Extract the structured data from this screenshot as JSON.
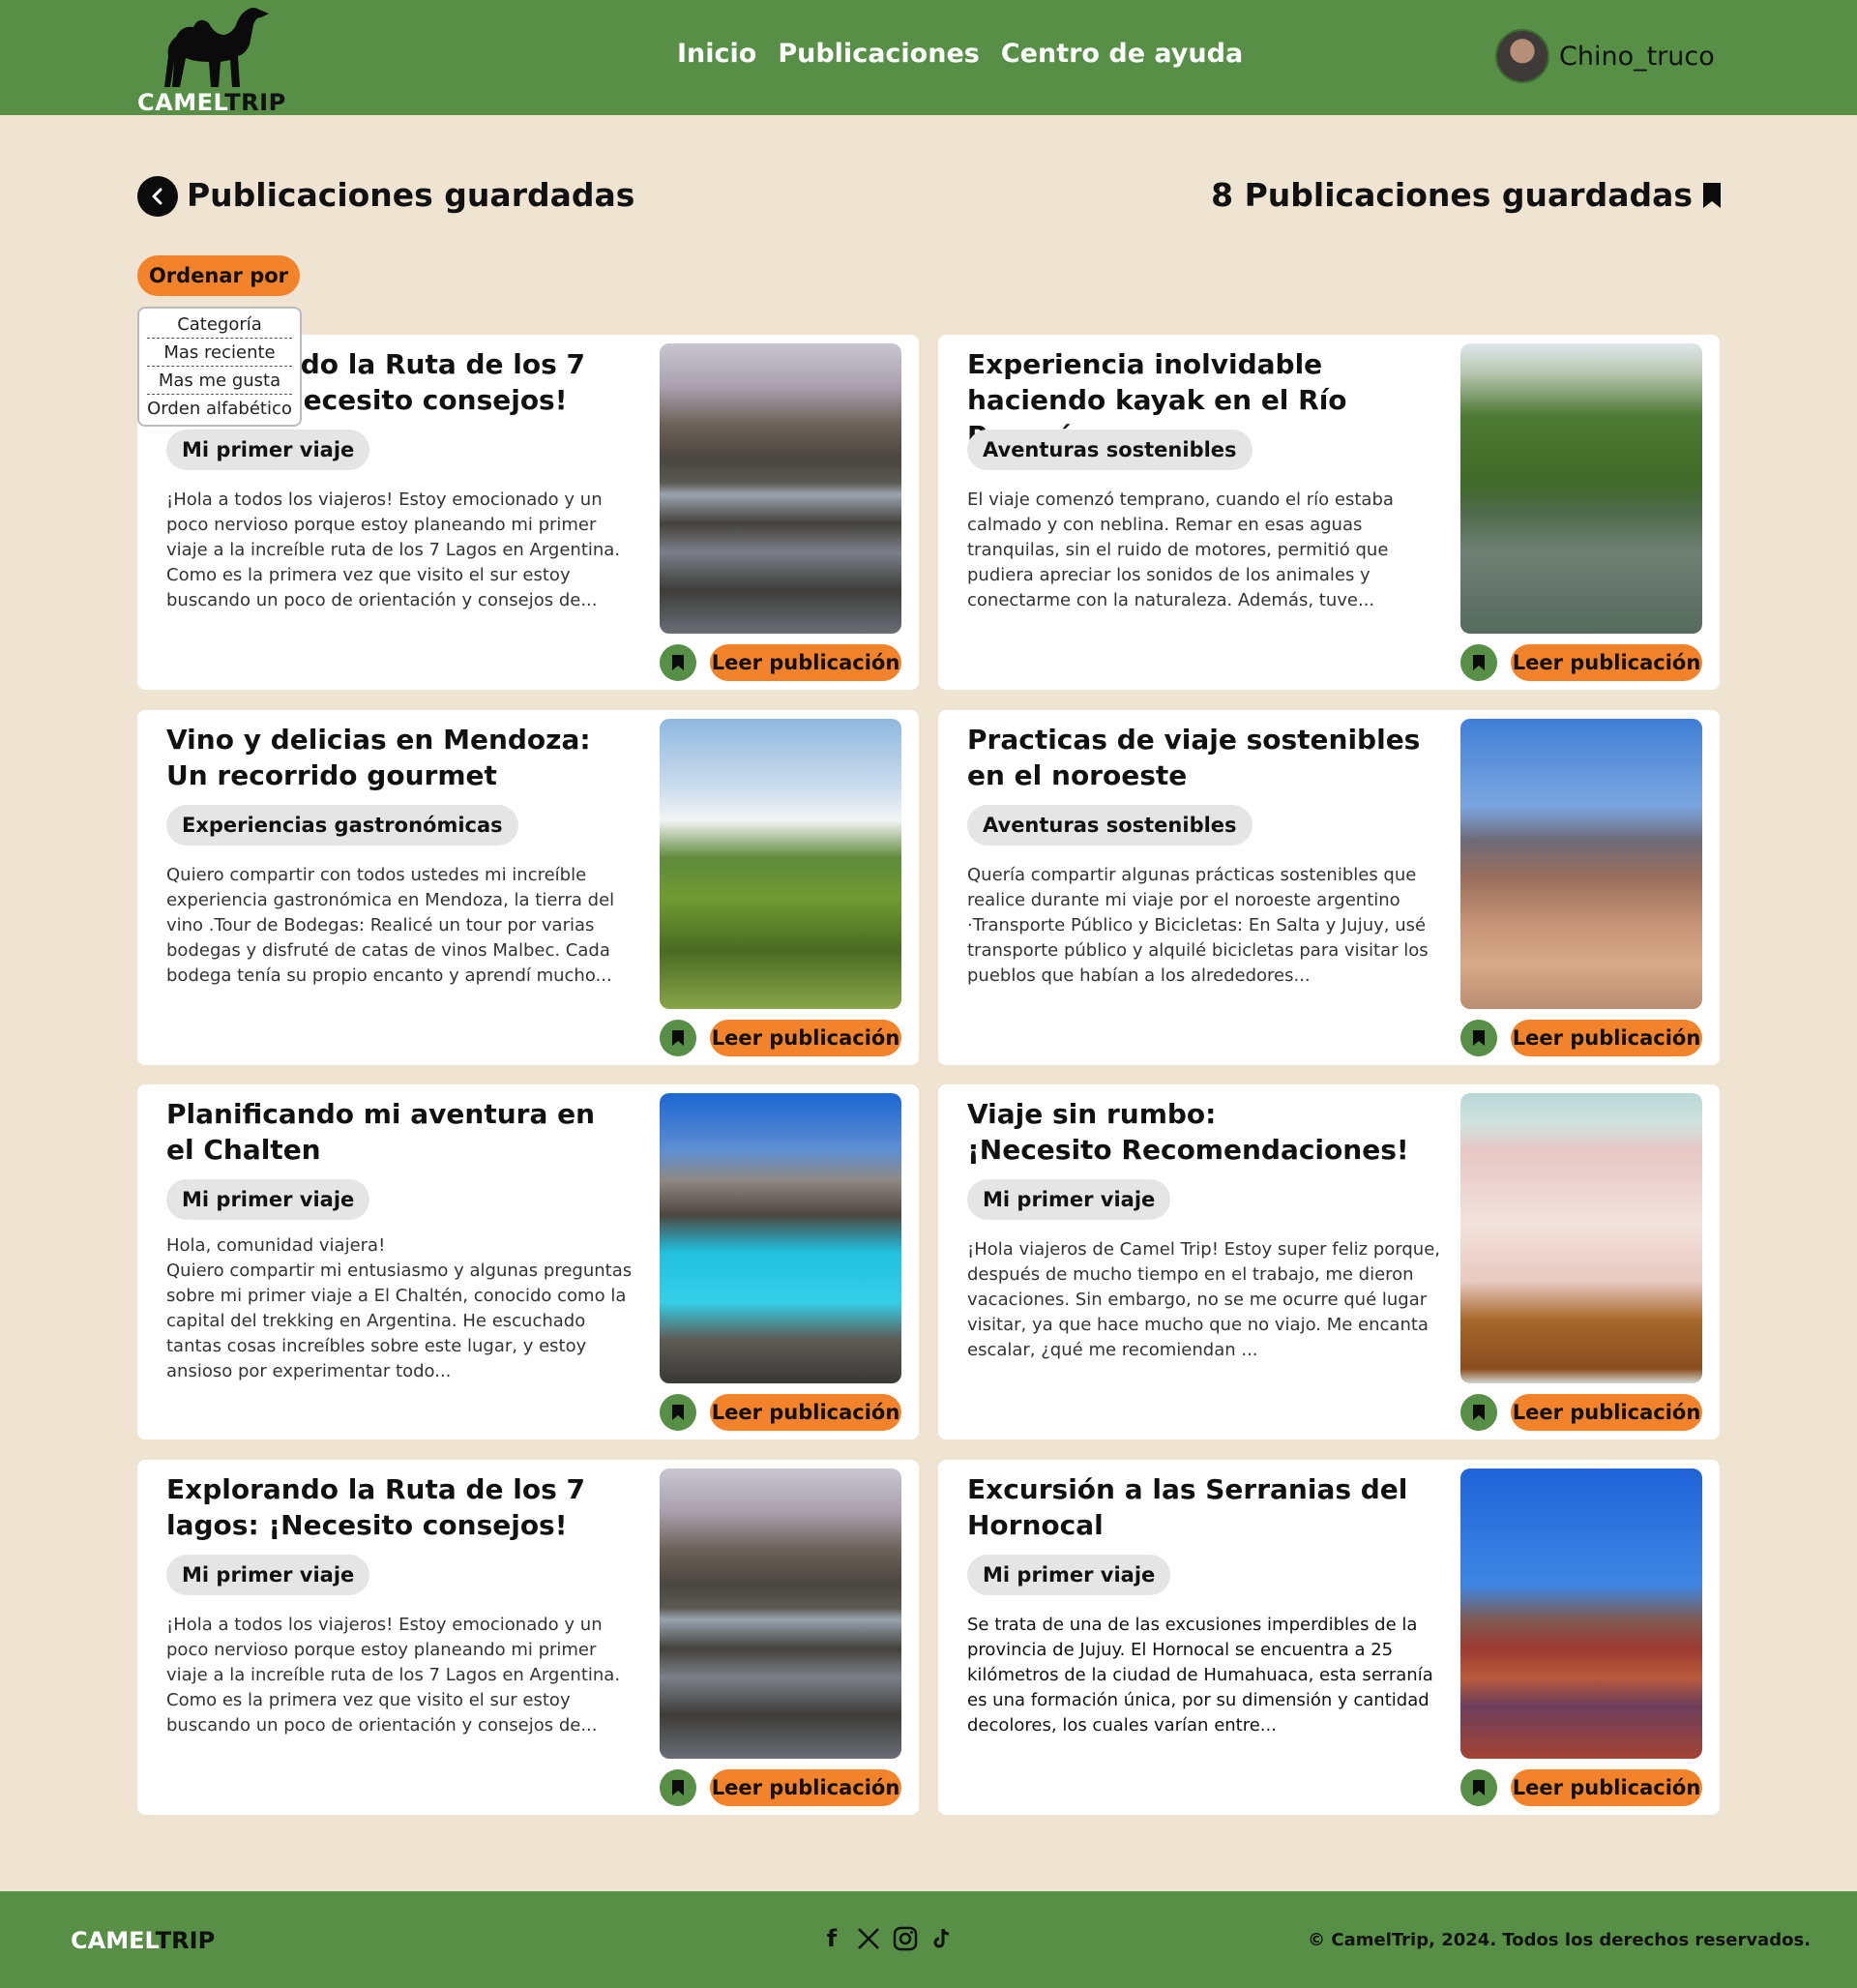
{
  "brand": {
    "camel": "CAMEL",
    "trip": "TRIP"
  },
  "nav": [
    "Inicio",
    "Publicaciones",
    "Centro de ayuda"
  ],
  "user": {
    "name": "Chino_truco"
  },
  "page": {
    "title": "Publicaciones guardadas",
    "saved_count": "8 Publicaciones guardadas"
  },
  "sort": {
    "label": "Ordenar por",
    "options": [
      "Categoría",
      "Mas reciente",
      "Mas me gusta",
      "Orden alfabético"
    ]
  },
  "posts": [
    {
      "title": "Explorando la Ruta de los 7 lagos: ¡Necesito consejos!",
      "tag": "Mi primer viaje",
      "excerpt": "¡Hola a todos los viajeros! Estoy emocionado y un poco nervioso porque estoy planeando mi primer viaje a la increíble ruta de los 7 Lagos en Argentina. Como es la primera vez que visito el sur estoy buscando un poco de orientación y consejos de...",
      "image": "lake-reflection-photo"
    },
    {
      "title": "Experiencia inolvidable haciendo kayak en el Río Paraná",
      "tag": "Aventuras sostenibles",
      "excerpt": "El viaje comenzó temprano, cuando el río estaba calmado y con neblina. Remar en esas aguas tranquilas, sin el ruido de motores, permitió que pudiera apreciar los sonidos de los animales y conectarme con la naturaleza. Además, tuve...",
      "image": "paddleboard-river-photo"
    },
    {
      "title": "Vino y delicias en Mendoza: Un recorrido gourmet",
      "tag": "Experiencias gastronómicas",
      "excerpt": "Quiero compartir con todos ustedes mi increíble experiencia gastronómica en Mendoza, la tierra del vino .Tour de Bodegas: Realicé un tour por varias bodegas y disfruté de catas de vinos Malbec. Cada bodega tenía su propio encanto y aprendí mucho...",
      "image": "wine-glass-vineyard-photo"
    },
    {
      "title": "Practicas de viaje sostenibles en el noroeste",
      "tag": "Aventuras sostenibles",
      "excerpt": "Quería compartir algunas prácticas sostenibles que realice durante mi viaje por el noroeste argentino ·Transporte Público y Bicicletas: En Salta y Jujuy, usé transporte público y alquilé bicicletas para visitar los pueblos que habían a los alrededores...",
      "image": "mountain-biker-photo"
    },
    {
      "title": "Planificando mi aventura en el Chalten",
      "tag": "Mi primer viaje",
      "excerpt": "Hola, comunidad viajera!\nQuiero compartir mi entusiasmo y algunas preguntas sobre mi primer viaje a El Chaltén, conocido como la capital del trekking en Argentina. He escuchado tantas cosas increíbles sobre este lugar, y estoy ansioso por experimentar todo...",
      "image": "turquoise-lake-hiker-photo"
    },
    {
      "title": "Viaje sin rumbo:\n¡Necesito Recomendaciones!",
      "tag": "Mi primer viaje",
      "excerpt": "¡Hola viajeros de Camel Trip! Estoy super feliz porque, después de mucho tiempo en el trabajo, me dieron vacaciones. Sin embargo, no se me ocurre qué lugar visitar, ya que hace mucho que no viajo. Me encanta escalar, ¿qué me recomiendan ...",
      "image": "open-suitcase-photo"
    },
    {
      "title": "Explorando la Ruta de los 7 lagos: ¡Necesito consejos!",
      "tag": "Mi primer viaje",
      "excerpt": "¡Hola a todos los viajeros! Estoy emocionado y un poco nervioso porque estoy planeando mi primer viaje a la increíble ruta de los 7 Lagos en Argentina. Como es la primera vez que visito el sur estoy buscando un poco de orientación y consejos de...",
      "image": "lake-reflection-photo"
    },
    {
      "title": "Excursión a las Serranias del Hornocal",
      "tag": "Mi primer viaje",
      "excerpt": "Se trata de una de las excusiones imperdibles de la provincia de Jujuy. El Hornocal se encuentra a 25 kilómetros de la ciudad de Humahuaca, esta serranía es una formación única, por su dimensión y cantidad decolores, los cuales varían entre...",
      "image": "colorful-mountains-photo"
    }
  ],
  "read_label": "Leer publicación",
  "footer": {
    "social": [
      "facebook-icon",
      "x-icon",
      "instagram-icon",
      "tiktok-icon"
    ],
    "copyright": "© CamelTrip, 2024. Todos los derechos reservados."
  },
  "colors": {
    "green": "#568f45",
    "orange": "#f2832a",
    "background": "#efe4d2"
  }
}
